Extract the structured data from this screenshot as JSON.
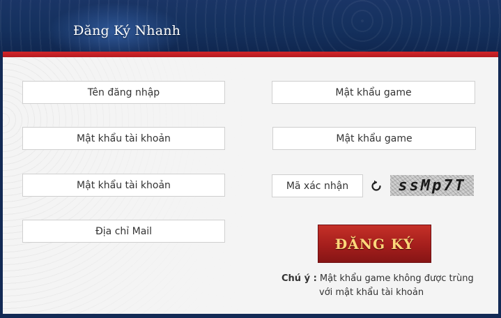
{
  "header": {
    "title": "Đăng Ký Nhanh"
  },
  "form": {
    "fields": [
      {
        "placeholder": "Tên đăng nhập"
      },
      {
        "placeholder": "Mật khẩu game"
      },
      {
        "placeholder": "Mật khẩu tài khoản"
      },
      {
        "placeholder": "Mật khẩu game"
      },
      {
        "placeholder": "Mật khẩu tài khoản"
      },
      {
        "placeholder": "Địa chỉ Mail"
      }
    ],
    "captcha_placeholder": "Mã xác nhận",
    "captcha_text": "ssMp7T",
    "submit_label": "ĐĂNG KÝ"
  },
  "note": {
    "label": "Chú ý :",
    "line1": "Mật khẩu game không được trùng",
    "line2": "với mật khẩu tài khoản"
  },
  "colors": {
    "header_bg": "#14305d",
    "accent_red": "#c53028",
    "button_text": "#ffd77a"
  },
  "icons": {
    "refresh": "refresh-icon"
  }
}
